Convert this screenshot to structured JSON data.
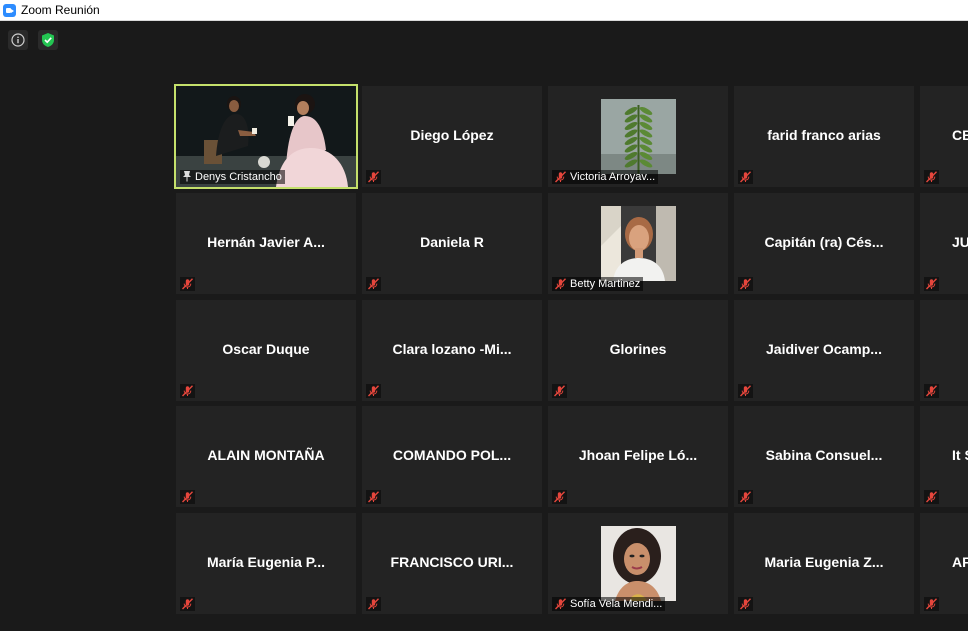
{
  "window": {
    "title": "Zoom Reunión"
  },
  "top_icons": [
    {
      "name": "info-icon"
    },
    {
      "name": "security-shield-icon",
      "color": "#23c552"
    }
  ],
  "colors": {
    "active_speaker_border": "#c4e06b",
    "mute_icon": "#e5463c"
  },
  "participants": [
    {
      "name": "Denys Cristancho",
      "type": "video",
      "pinned": true,
      "active": true
    },
    {
      "name": "Diego López",
      "type": "name"
    },
    {
      "name": "Victoria Arroyav...",
      "type": "photo",
      "photo": "fern-leaf"
    },
    {
      "name": "farid franco arias",
      "type": "name"
    },
    {
      "name": "CE",
      "type": "name"
    },
    {
      "name": "Hernán  Javier  A...",
      "type": "name"
    },
    {
      "name": "Daniela R",
      "type": "name"
    },
    {
      "name": "Betty Martinez",
      "type": "photo",
      "photo": "woman-portrait"
    },
    {
      "name": "Capitán  (ra)  Cés...",
      "type": "name"
    },
    {
      "name": "JU",
      "type": "name"
    },
    {
      "name": "Oscar Duque",
      "type": "name"
    },
    {
      "name": "Clara  lozano  -Mi...",
      "type": "name"
    },
    {
      "name": "Glorines",
      "type": "name"
    },
    {
      "name": "Jaidiver  Ocamp...",
      "type": "name"
    },
    {
      "name": "",
      "type": "name"
    },
    {
      "name": "ALAIN MONTAÑA",
      "type": "name"
    },
    {
      "name": "COMANDO  POL...",
      "type": "name"
    },
    {
      "name": "Jhoan  Felipe  Ló...",
      "type": "name"
    },
    {
      "name": "Sabina  Consuel...",
      "type": "name"
    },
    {
      "name": "It S",
      "type": "name"
    },
    {
      "name": "María  Eugenia  P...",
      "type": "name"
    },
    {
      "name": "FRANCISCO  URI...",
      "type": "name"
    },
    {
      "name": "Sofía Vela Mendi...",
      "type": "photo",
      "photo": "woman-selfie"
    },
    {
      "name": "Maria  Eugenia  Z...",
      "type": "name"
    },
    {
      "name": "AF",
      "type": "name"
    }
  ]
}
